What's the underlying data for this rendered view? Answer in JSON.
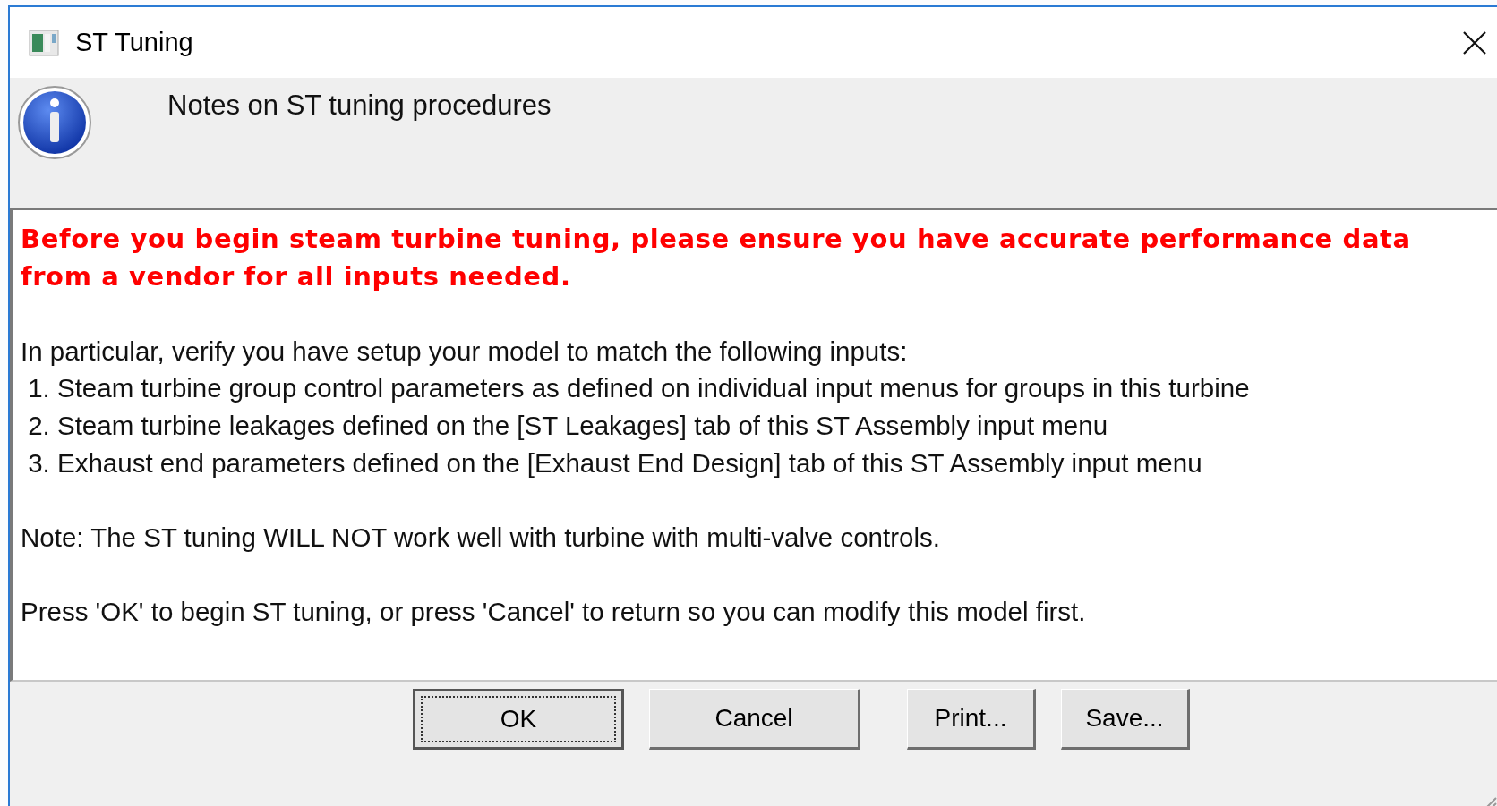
{
  "window": {
    "title": "ST Tuning"
  },
  "header": {
    "text": "Notes on ST tuning procedures"
  },
  "notes": [
    {
      "kind": "warning",
      "text": "Before you begin steam turbine tuning, please ensure you have accurate performance data from a vendor for all inputs needed."
    },
    {
      "kind": "paragraph",
      "text": "In particular, verify you have setup your model to match the following inputs:"
    },
    {
      "kind": "list_item",
      "text": " 1. Steam turbine group control parameters as defined on individual input menus for groups in this turbine"
    },
    {
      "kind": "list_item",
      "text": " 2. Steam turbine leakages defined on the [ST Leakages] tab of this ST Assembly input menu"
    },
    {
      "kind": "list_item",
      "text": " 3. Exhaust end parameters defined on the [Exhaust End Design] tab of this ST Assembly input menu"
    },
    {
      "kind": "paragraph",
      "text": "Note: The ST tuning WILL NOT work well with turbine with multi-valve controls."
    },
    {
      "kind": "paragraph",
      "text": "Press 'OK' to begin ST tuning, or press 'Cancel' to return so you can modify this model first."
    }
  ],
  "buttons": [
    {
      "label": "OK",
      "kind": "default"
    },
    {
      "label": "Cancel",
      "kind": "normal"
    },
    {
      "label": "Print...",
      "kind": "small"
    },
    {
      "label": "Save...",
      "kind": "small"
    }
  ]
}
